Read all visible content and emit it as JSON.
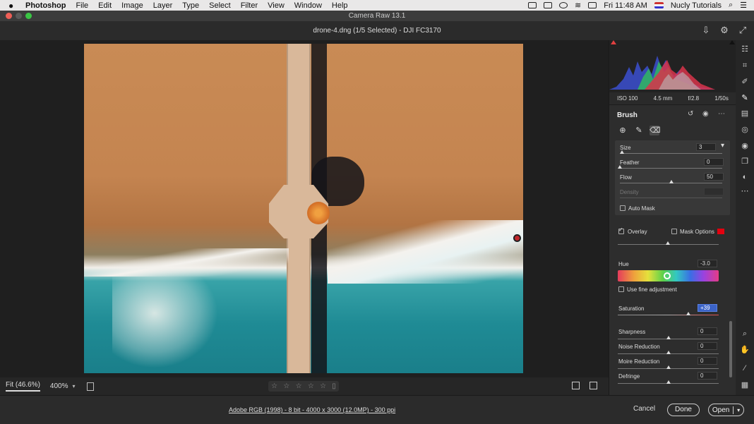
{
  "menubar": {
    "items": [
      "Photoshop",
      "File",
      "Edit",
      "Image",
      "Layer",
      "Type",
      "Select",
      "Filter",
      "View",
      "Window",
      "Help"
    ],
    "clock": "Fri 11:48 AM",
    "user": "Nucly Tutorials"
  },
  "window": {
    "title": "Camera Raw 13.1"
  },
  "header": {
    "file_label": "drone-4.dng (1/5 Selected)  -  DJI FC3170"
  },
  "histogram": {
    "iso": "ISO 100",
    "focal": "4.5 mm",
    "aperture": "f/2.8",
    "shutter": "1/50s"
  },
  "brush": {
    "title": "Brush",
    "size": {
      "label": "Size",
      "value": "3",
      "level": 0.02
    },
    "feather": {
      "label": "Feather",
      "value": "0",
      "level": 0.0
    },
    "flow": {
      "label": "Flow",
      "value": "50",
      "level": 0.5
    },
    "density": {
      "label": "Density",
      "value": ""
    },
    "auto_mask": {
      "label": "Auto Mask",
      "checked": false
    }
  },
  "overlay": {
    "label": "Overlay",
    "checked": true,
    "mask_options": "Mask Options",
    "mask_color": "#e3000f"
  },
  "adjustments": {
    "hue": {
      "label": "Hue",
      "value": "-3.0",
      "level": 0.49
    },
    "fine": {
      "label": "Use fine adjustment",
      "checked": false
    },
    "saturation": {
      "label": "Saturation",
      "value": "+39",
      "level": 0.7
    },
    "sharpness": {
      "label": "Sharpness",
      "value": "0",
      "level": 0.5
    },
    "noise": {
      "label": "Noise Reduction",
      "value": "0",
      "level": 0.5
    },
    "moire": {
      "label": "Moire Reduction",
      "value": "0",
      "level": 0.5
    },
    "defringe": {
      "label": "Defringe",
      "value": "0",
      "level": 0.5
    }
  },
  "viewbar": {
    "fit": "Fit (46.6%)",
    "zoom": "400%"
  },
  "footer": {
    "info": "Adobe RGB (1998) - 8 bit - 4000 x 3000 (12.0MP) - 300 ppi",
    "cancel": "Cancel",
    "done": "Done",
    "open": "Open"
  }
}
